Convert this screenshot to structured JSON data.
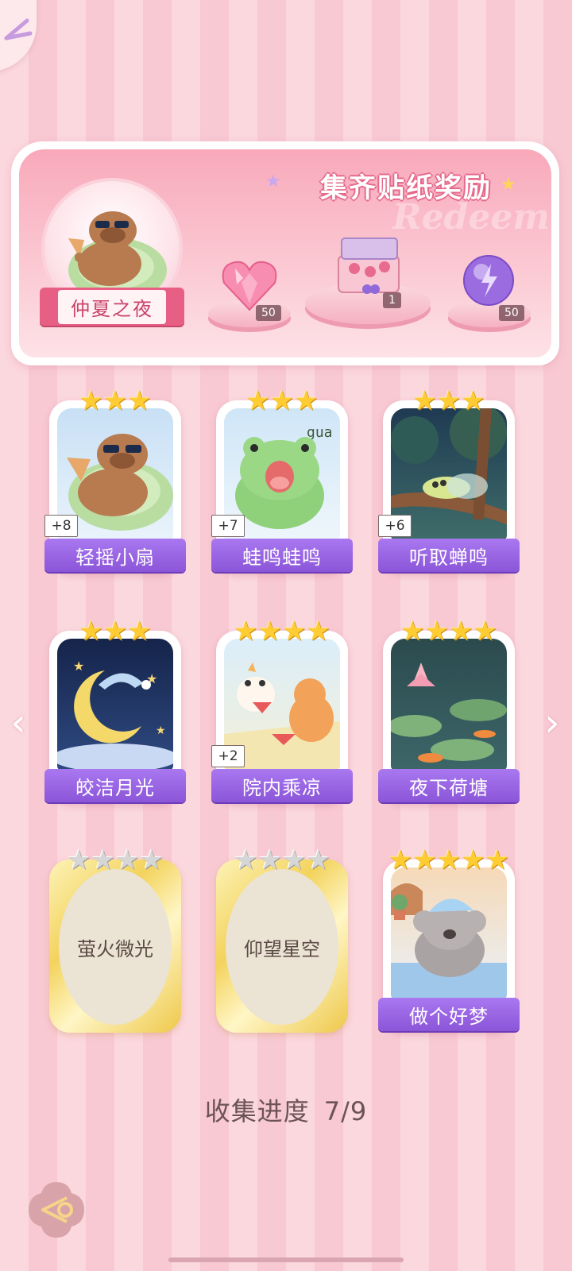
{
  "banner": {
    "title": "集齐贴纸奖励",
    "watermark": "Redeem",
    "theme_name": "仲夏之夜",
    "rewards": [
      {
        "icon": "pink-heart-gem-icon",
        "count": "50"
      },
      {
        "icon": "gift-box-icon",
        "count": "1"
      },
      {
        "icon": "purple-lightning-orb-icon",
        "count": "50"
      }
    ]
  },
  "cards": [
    {
      "name": "轻摇小扇",
      "stars": 3,
      "bonus": "+8",
      "collected": true
    },
    {
      "name": "蛙鸣蛙鸣",
      "stars": 3,
      "bonus": "+7",
      "collected": true
    },
    {
      "name": "听取蝉鸣",
      "stars": 3,
      "bonus": "+6",
      "collected": true
    },
    {
      "name": "皎洁月光",
      "stars": 3,
      "bonus": "",
      "collected": true
    },
    {
      "name": "院内乘凉",
      "stars": 4,
      "bonus": "+2",
      "collected": true
    },
    {
      "name": "夜下荷塘",
      "stars": 4,
      "bonus": "",
      "collected": true
    },
    {
      "name": "萤火微光",
      "stars": 4,
      "bonus": "",
      "collected": false
    },
    {
      "name": "仰望星空",
      "stars": 4,
      "bonus": "",
      "collected": false
    },
    {
      "name": "做个好梦",
      "stars": 5,
      "bonus": "",
      "collected": true
    }
  ],
  "progress": {
    "label": "收集进度",
    "value": "7/9"
  }
}
